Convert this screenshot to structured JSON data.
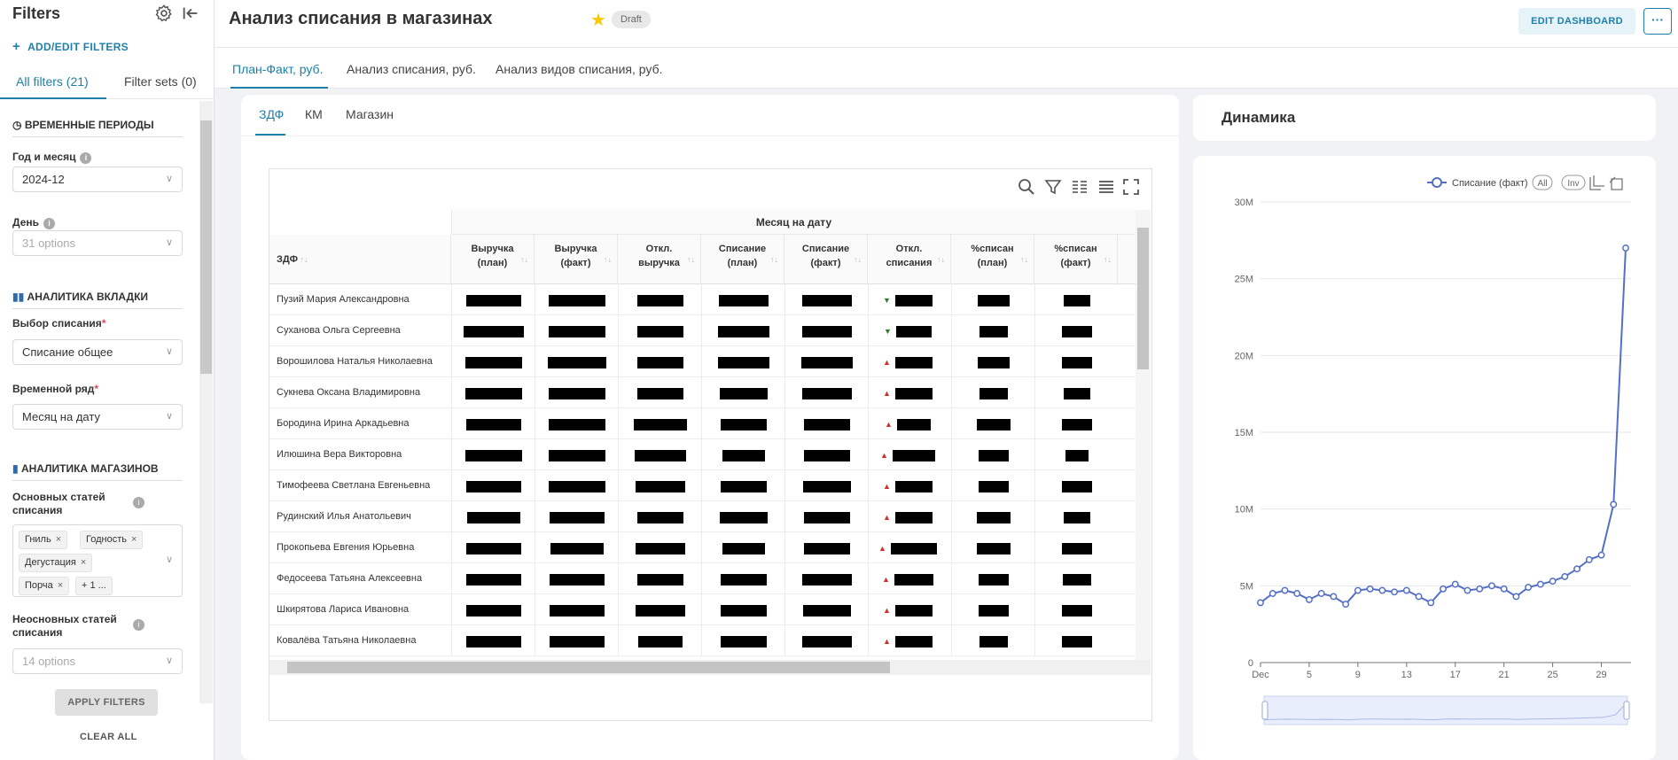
{
  "sidebar": {
    "title": "Filters",
    "add_edit": "ADD/EDIT FILTERS",
    "tab_all": "All filters (21)",
    "tab_sets": "Filter sets (0)",
    "sections": {
      "time": "ВРЕМЕННЫЕ ПЕРИОДЫ",
      "tab_analytics": "АНАЛИТИКА ВКЛАДКИ",
      "store_analytics": "АНАЛИТИКА МАГАЗИНОВ"
    },
    "filters": {
      "year_month": {
        "label": "Год и месяц",
        "value": "2024-12"
      },
      "day": {
        "label": "День",
        "placeholder": "31 options"
      },
      "writeoff_choice": {
        "label": "Выбор списания",
        "value": "Списание общее"
      },
      "time_series": {
        "label": "Временной ряд",
        "value": "Месяц на дату"
      },
      "main_items": {
        "label": "Основных статей списания",
        "tags": [
          "Гниль",
          "Годность",
          "Дегустация",
          "Порча"
        ],
        "more": "+ 1 ..."
      },
      "non_main_items": {
        "label": "Неосновных статей списания",
        "placeholder": "14 options"
      }
    },
    "apply": "APPLY FILTERS",
    "clear": "CLEAR ALL"
  },
  "header": {
    "title": "Анализ списания в магазинах",
    "status": "Draft",
    "edit": "EDIT DASHBOARD",
    "more": "···"
  },
  "top_tabs": [
    "План-Факт, руб.",
    "Анализ списания, руб.",
    "Анализ видов списания, руб."
  ],
  "sub_tabs": [
    "ЗДФ",
    "КМ",
    "Магазин"
  ],
  "table": {
    "group_header": "Месяц на дату",
    "first_col": "ЗДФ",
    "columns": [
      {
        "l1": "Выручка",
        "l2": "(план)"
      },
      {
        "l1": "Выручка",
        "l2": "(факт)"
      },
      {
        "l1": "Откл.",
        "l2": "выручка"
      },
      {
        "l1": "Списание",
        "l2": "(план)"
      },
      {
        "l1": "Списание",
        "l2": "(факт)"
      },
      {
        "l1": "Откл.",
        "l2": "списания"
      },
      {
        "l1": "%списан",
        "l2": "(план)"
      },
      {
        "l1": "%списан",
        "l2": "(факт)"
      }
    ],
    "rows": [
      {
        "name": "Пузий Мария Александровна",
        "trend": "down"
      },
      {
        "name": "Суханова Ольга Сергеевна",
        "trend": "down"
      },
      {
        "name": "Ворошилова Наталья Николаевна",
        "trend": "up"
      },
      {
        "name": "Сукнева Оксана Владимировна",
        "trend": "up"
      },
      {
        "name": "Бородина Ирина Аркадьевна",
        "trend": "up"
      },
      {
        "name": "Илюшина Вера Викторовна",
        "trend": "up"
      },
      {
        "name": "Тимофеева Светлана Евгеньевна",
        "trend": "up"
      },
      {
        "name": "Рудинский Илья Анатольевич",
        "trend": "up"
      },
      {
        "name": "Прокопьева Евгения Юрьевна",
        "trend": "up"
      },
      {
        "name": "Федосеева Татьяна Алексеевна",
        "trend": "up"
      },
      {
        "name": "Шкирятова Лариса Ивановна",
        "trend": "up"
      },
      {
        "name": "Ковалёва Татьяна Николаевна",
        "trend": "up"
      }
    ]
  },
  "chart_title": "Динамика",
  "chart_data": {
    "type": "line",
    "title": "",
    "legend": "Списание (факт)",
    "legend_buttons": [
      "All",
      "Inv"
    ],
    "x_ticks": [
      "Dec",
      "5",
      "9",
      "13",
      "17",
      "21",
      "25",
      "29"
    ],
    "y_ticks": [
      "0",
      "5M",
      "10M",
      "15M",
      "20M",
      "25M",
      "30M"
    ],
    "ylim": [
      0,
      30000000
    ],
    "x": [
      1,
      2,
      3,
      4,
      5,
      6,
      7,
      8,
      9,
      10,
      11,
      12,
      13,
      14,
      15,
      16,
      17,
      18,
      19,
      20,
      21,
      22,
      23,
      24,
      25,
      26,
      27,
      28,
      29,
      30,
      31
    ],
    "values": [
      3900000,
      4500000,
      4700000,
      4500000,
      4100000,
      4500000,
      4300000,
      3800000,
      4700000,
      4800000,
      4700000,
      4600000,
      4700000,
      4300000,
      3900000,
      4800000,
      5100000,
      4700000,
      4800000,
      5000000,
      4800000,
      4300000,
      4900000,
      5100000,
      5300000,
      5600000,
      6100000,
      6700000,
      7000000,
      10300000,
      27000000
    ],
    "color": "#5470c6"
  }
}
